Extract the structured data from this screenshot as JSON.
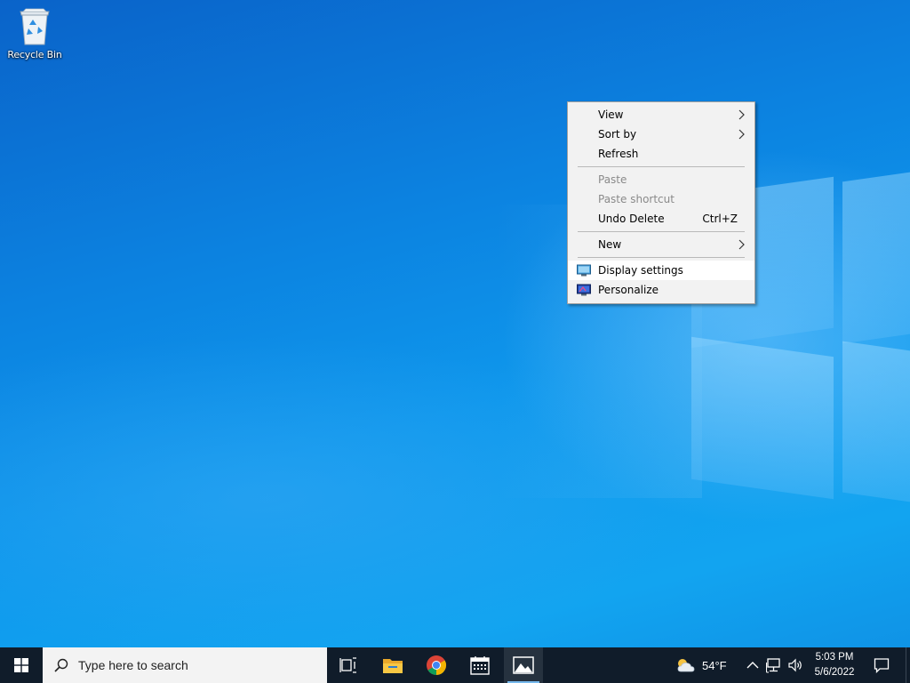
{
  "desktop": {
    "icons": [
      {
        "label": "Recycle Bin",
        "icon": "recycle-bin-icon"
      }
    ]
  },
  "context_menu": {
    "items": [
      {
        "label": "View",
        "submenu": true,
        "enabled": true
      },
      {
        "label": "Sort by",
        "submenu": true,
        "enabled": true
      },
      {
        "label": "Refresh",
        "enabled": true
      },
      {
        "label": "Paste",
        "enabled": false
      },
      {
        "label": "Paste shortcut",
        "enabled": false
      },
      {
        "label": "Undo Delete",
        "shortcut": "Ctrl+Z",
        "enabled": true
      },
      {
        "label": "New",
        "submenu": true,
        "enabled": true
      },
      {
        "label": "Display settings",
        "icon": "display-settings-icon",
        "enabled": true,
        "highlighted": true
      },
      {
        "label": "Personalize",
        "icon": "personalize-icon",
        "enabled": true
      }
    ]
  },
  "taskbar": {
    "search_placeholder": "Type here to search",
    "pinned_apps": [
      {
        "name": "Task View",
        "icon": "task-view-icon"
      },
      {
        "name": "File Explorer",
        "icon": "file-explorer-icon"
      },
      {
        "name": "Google Chrome",
        "icon": "chrome-icon"
      },
      {
        "name": "Calendar",
        "icon": "calendar-icon"
      },
      {
        "name": "Photos",
        "icon": "photos-icon",
        "active": true
      }
    ],
    "weather": {
      "temperature": "54°F",
      "icon": "partly-cloudy-icon"
    },
    "tray_icons": [
      "chevron-up-icon",
      "network-icon",
      "volume-icon"
    ],
    "clock": {
      "time": "5:03 PM",
      "date": "5/6/2022"
    }
  },
  "colors": {
    "desktop_blue": "#0a78d7",
    "taskbar": "#101c2a",
    "menu_background": "#f2f2f2",
    "menu_disabled_text": "#8a8a8a"
  }
}
